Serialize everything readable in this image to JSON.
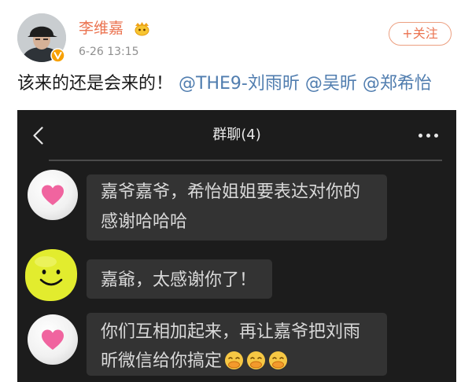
{
  "post": {
    "author_name": "李维嘉",
    "timestamp": "6-26 13:15",
    "follow_label": "+关注",
    "text": "该来的还是会来的！",
    "mentions": [
      "@THE9-刘雨昕",
      "@吴昕",
      "@郑希怡"
    ],
    "icons": {
      "avatar": "user-avatar",
      "verified": "verified-v-icon",
      "badge": "vip-badge-icon"
    }
  },
  "chat_screenshot": {
    "title": "群聊(4)",
    "icons": {
      "back": "back-chevron-icon",
      "more": "more-dots-icon"
    },
    "messages": [
      {
        "avatar_icon": "pink-heart-avatar",
        "lines": [
          "嘉爷嘉爷，希怡姐姐要表达对你的",
          "感谢哈哈哈"
        ]
      },
      {
        "avatar_icon": "yellow-smiley-avatar",
        "lines": [
          "嘉爺，太感谢你了！"
        ]
      },
      {
        "avatar_icon": "pink-heart-avatar",
        "lines": [
          "你们互相加起来，再让嘉爷把刘雨",
          "昕微信给你搞定"
        ],
        "trailing_emojis": [
          "covering-mouth-laugh-emoji",
          "covering-mouth-laugh-emoji",
          "covering-mouth-laugh-emoji"
        ]
      }
    ]
  },
  "colors": {
    "author_name": "#eb7350",
    "mention": "#507daf",
    "timestamp": "#8f8f8f",
    "chat_background": "#1c1c1c",
    "chat_bubble": "#333333",
    "heart": "#f0649f",
    "smiley": "#e2ec2e",
    "verified_badge": "#f7a000"
  }
}
